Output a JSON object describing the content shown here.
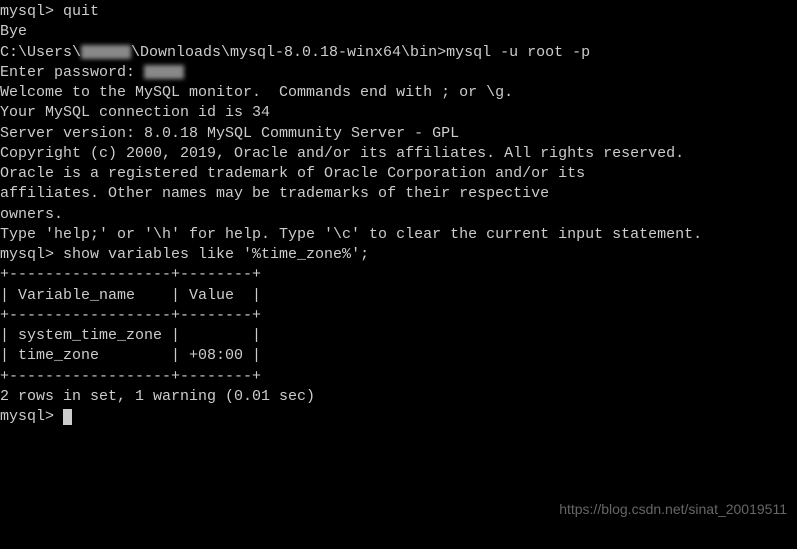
{
  "lines": {
    "l1_prompt": "mysql> ",
    "l1_cmd": "quit",
    "l2": "Bye",
    "blank": "",
    "l3_path": "C:\\Users\\",
    "l3_rest": "\\Downloads\\mysql-8.0.18-winx64\\bin>",
    "l3_cmd": "mysql -u root -p",
    "l4": "Enter password: ",
    "l5": "Welcome to the MySQL monitor.  Commands end with ; or \\g.",
    "l6": "Your MySQL connection id is 34",
    "l7": "Server version: 8.0.18 MySQL Community Server - GPL",
    "l8": "Copyright (c) 2000, 2019, Oracle and/or its affiliates. All rights reserved.",
    "l9": "Oracle is a registered trademark of Oracle Corporation and/or its",
    "l10": "affiliates. Other names may be trademarks of their respective",
    "l11": "owners.",
    "l12": "Type 'help;' or '\\h' for help. Type '\\c' to clear the current input statement.",
    "l13_prompt": "mysql> ",
    "l13_cmd": "show variables like '%time_zone%';",
    "tbl_top": "+------------------+--------+",
    "tbl_header": "| Variable_name    | Value  |",
    "tbl_sep": "+------------------+--------+",
    "tbl_row1": "| system_time_zone |        |",
    "tbl_row2": "| time_zone        | +08:00 |",
    "tbl_bottom": "+------------------+--------+",
    "l14": "2 rows in set, 1 warning (0.01 sec)",
    "l15_prompt": "mysql> "
  },
  "chart_data": {
    "type": "table",
    "title": "show variables like '%time_zone%'",
    "columns": [
      "Variable_name",
      "Value"
    ],
    "rows": [
      {
        "Variable_name": "system_time_zone",
        "Value": ""
      },
      {
        "Variable_name": "time_zone",
        "Value": "+08:00"
      }
    ],
    "summary": "2 rows in set, 1 warning (0.01 sec)"
  },
  "watermark": "https://blog.csdn.net/sinat_20019511"
}
